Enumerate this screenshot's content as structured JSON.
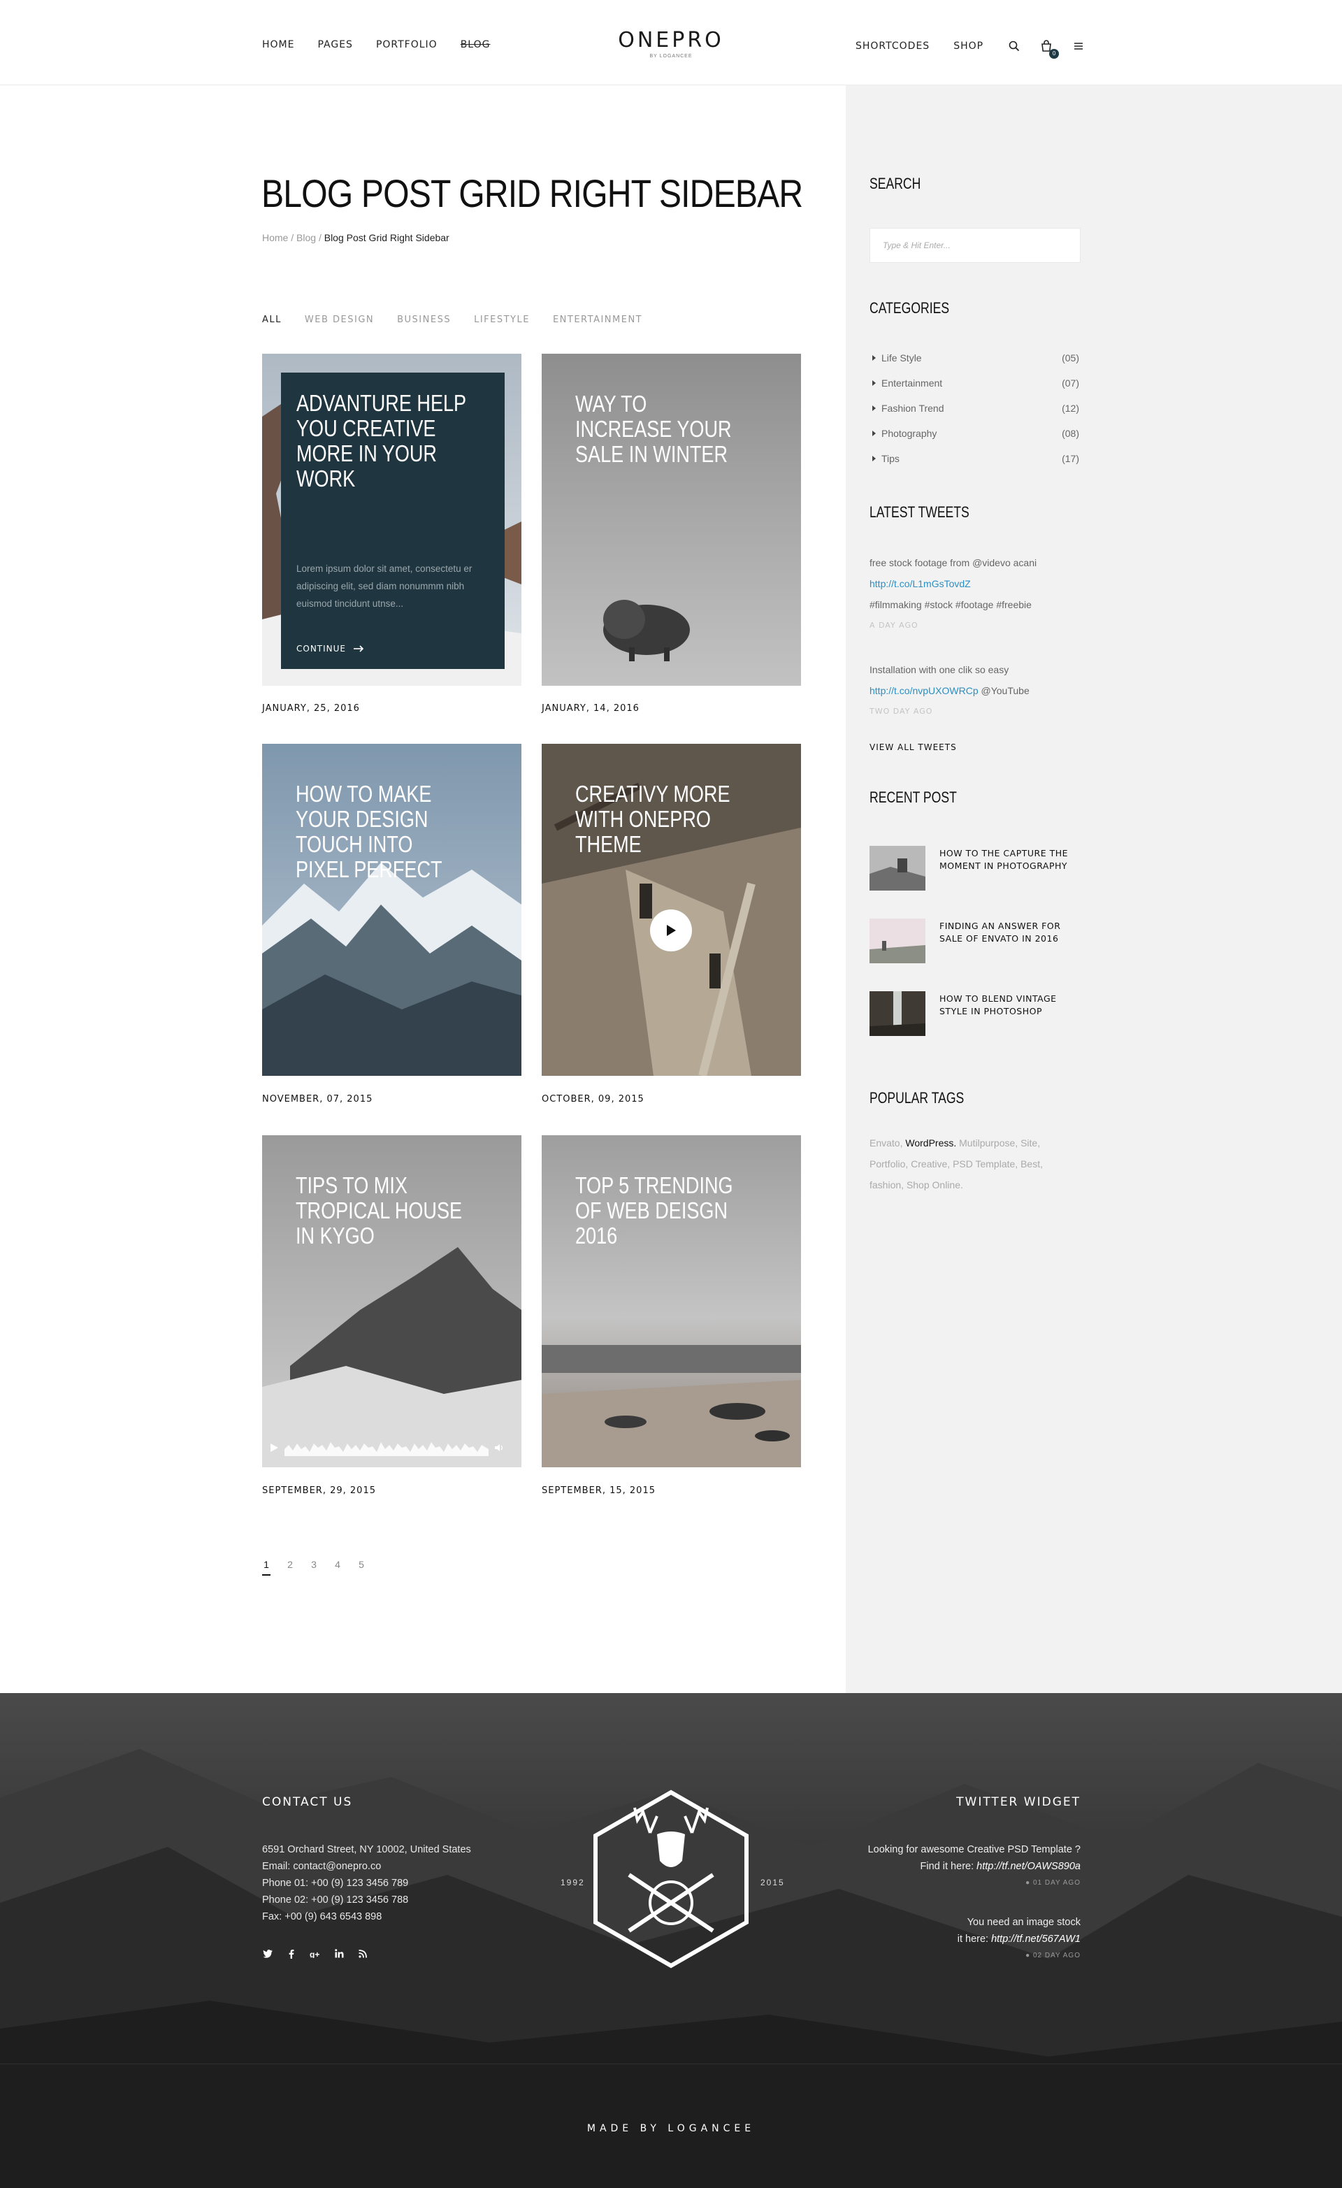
{
  "header": {
    "nav_left": [
      "HOME",
      "PAGES",
      "PORTFOLIO",
      "BLOG"
    ],
    "logo": "ONEPRO",
    "logo_sub": "BY LOGANCEE",
    "nav_right": [
      "SHORTCODES",
      "SHOP"
    ],
    "cart_count": "0",
    "icons": [
      "search-icon",
      "cart-icon",
      "menu-icon"
    ]
  },
  "page": {
    "title": "BLOG POST GRID RIGHT SIDEBAR",
    "breadcrumb": [
      "Home",
      "Blog",
      "Blog Post Grid Right Sidebar"
    ],
    "breadcrumb_sep": " / "
  },
  "filters": [
    "ALL",
    "WEB DESIGN",
    "BUSINESS",
    "LIFESTYLE",
    "ENTERTAINMENT"
  ],
  "posts": [
    {
      "title": "ADVANTURE HELP YOU CREATIVE MORE IN YOUR WORK",
      "date": "JANUARY, 25, 2016",
      "excerpt": "Lorem ipsum dolor sit amet, consectetu er adipiscing elit, sed diam nonummm nibh euismod tincidunt utnse...",
      "more": "CONTINUE"
    },
    {
      "title": "WAY TO INCREASE YOUR SALE IN WINTER",
      "date": "JANUARY, 14, 2016"
    },
    {
      "title": "HOW TO MAKE YOUR DESIGN TOUCH INTO PIXEL PERFECT",
      "date": "NOVEMBER, 07, 2015"
    },
    {
      "title": "CREATIVY MORE WITH ONEPRO THEME",
      "date": "OCTOBER, 09, 2015"
    },
    {
      "title": "TIPS TO MIX TROPICAL HOUSE IN KYGO",
      "date": "SEPTEMBER, 29, 2015"
    },
    {
      "title": "TOP 5 TRENDING OF WEB DEISGN 2016",
      "date": "SEPTEMBER, 15, 2015"
    }
  ],
  "pagination": [
    "1",
    "2",
    "3",
    "4",
    "5"
  ],
  "sidebar": {
    "search_title": "SEARCH",
    "search_placeholder": "Type & Hit Enter...",
    "categories_title": "CATEGORIES",
    "categories": [
      {
        "label": "Life Style",
        "count": "(05)"
      },
      {
        "label": "Entertainment",
        "count": "(07)"
      },
      {
        "label": "Fashion Trend",
        "count": "(12)"
      },
      {
        "label": "Photography",
        "count": "(08)"
      },
      {
        "label": "Tips",
        "count": "(17)"
      }
    ],
    "tweets_title": "LATEST TWEETS",
    "tweets": [
      {
        "line1": "free stock footage from @videvo acani",
        "link": "http://t.co/L1mGsTovdZ",
        "line3": "#filmmaking #stock #footage #freebie",
        "ago": "A DAY AGO"
      },
      {
        "line1": "Installation with one clik so easy",
        "link": "http://t.co/nvpUXOWRCp",
        "after_link": " @YouTube",
        "ago": "TWO DAY AGO"
      }
    ],
    "view_all": "VIEW ALL TWEETS",
    "recent_title": "RECENT POST",
    "recent": [
      {
        "title": "HOW TO THE CAPTURE THE MOMENT IN PHOTOGRAPHY"
      },
      {
        "title": "FINDING AN ANSWER FOR SALE OF ENVATO IN 2016"
      },
      {
        "title": "HOW TO BLEND VINTAGE STYLE IN PHOTOSHOP"
      }
    ],
    "tags_title": "POPULAR TAGS",
    "tags": [
      {
        "label": "Envato",
        "sep": ", ",
        "highlight": false
      },
      {
        "label": "WordPress.",
        "sep": " ",
        "highlight": true
      },
      {
        "label": "Mutilpurpose",
        "sep": ", ",
        "highlight": false
      },
      {
        "label": "Site",
        "sep": ", ",
        "highlight": false
      },
      {
        "label": "Portfolio",
        "sep": ", ",
        "highlight": false
      },
      {
        "label": "Creative",
        "sep": ", ",
        "highlight": false
      },
      {
        "label": "PSD Template",
        "sep": ", ",
        "highlight": false
      },
      {
        "label": "Best",
        "sep": ", ",
        "highlight": false
      },
      {
        "label": "fashion",
        "sep": ", ",
        "highlight": false
      },
      {
        "label": "Shop Online.",
        "sep": "",
        "highlight": false
      }
    ]
  },
  "footer": {
    "contact_title": "CONTACT US",
    "contact_lines": [
      "6591 Orchard Street, NY 10002, United States",
      "Email: contact@onepro.co",
      "Phone 01: +00 (9) 123 3456 789",
      "Phone 02: +00 (9) 123 3456 788",
      "Fax: +00 (9) 643 6543 898"
    ],
    "social": [
      "twitter-icon",
      "facebook-icon",
      "google-plus-icon",
      "linkedin-icon",
      "rss-icon"
    ],
    "year_left": "1992",
    "year_right": "2015",
    "twitter_title": "TWITTER WIDGET",
    "tweets": [
      {
        "line1": "Looking for awesome Creative PSD Template ?",
        "line2_prefix": "Find it here: ",
        "line2_link": "http://tf.net/OAWS890a",
        "ago": "01 DAY AGO"
      },
      {
        "line1": "You need an image stock",
        "line2_prefix": "it here: ",
        "line2_link": "http://tf.net/567AW1",
        "ago": "02 DAY AGO"
      }
    ],
    "copyright": "MADE BY LOGANCEE"
  }
}
